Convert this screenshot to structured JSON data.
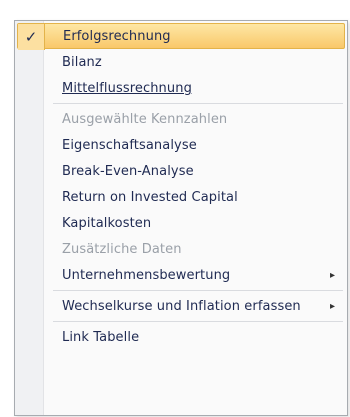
{
  "menu": {
    "items": [
      {
        "label": "Erfolgsrechnung",
        "checked": true,
        "selected": true
      },
      {
        "label": "Bilanz"
      },
      {
        "label": "Mittelflussrechnung"
      },
      {
        "label": "Ausgewählte Kennzahlen",
        "disabled": true
      },
      {
        "label": "Eigenschaftsanalyse"
      },
      {
        "label": "Break-Even-Analyse"
      },
      {
        "label": "Return on Invested Capital"
      },
      {
        "label": "Kapitalkosten"
      },
      {
        "label": "Zusätzliche Daten",
        "disabled": true
      },
      {
        "label": "Unternehmensbewertung",
        "submenu": true
      },
      {
        "label": "Wechselkurse und Inflation erfassen",
        "submenu": true
      },
      {
        "label": "Link Tabelle"
      }
    ],
    "check_icon": "checkmark-icon",
    "submenu_icon": "chevron-right-icon"
  }
}
